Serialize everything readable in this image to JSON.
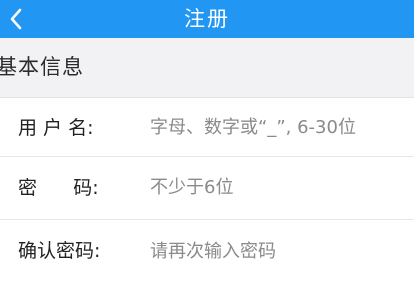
{
  "header": {
    "title": "注册",
    "back_icon": "chevron-left-icon",
    "background_color": "#2296f3"
  },
  "section": {
    "title": "基本信息"
  },
  "form": {
    "username": {
      "label": "用 户 名:",
      "placeholder": "字母、数字或“_”, 6-30位"
    },
    "password": {
      "label": "密      码:",
      "placeholder": "不少于6位"
    },
    "confirm_password": {
      "label": "确认密码:",
      "placeholder": "请再次输入密码"
    }
  }
}
